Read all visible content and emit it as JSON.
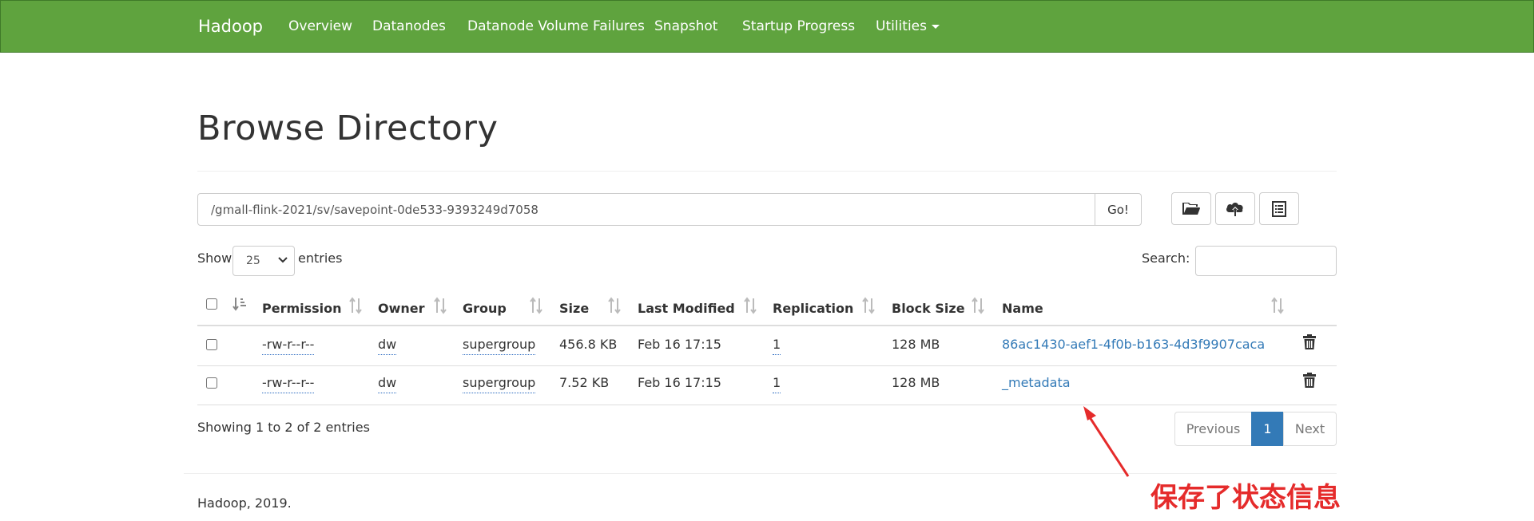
{
  "navbar": {
    "brand": "Hadoop",
    "items": [
      "Overview",
      "Datanodes",
      "Datanode Volume Failures",
      "Snapshot",
      "Startup Progress",
      "Utilities"
    ],
    "color": "#5fa33e"
  },
  "page": {
    "title": "Browse Directory"
  },
  "path_bar": {
    "value": "/gmall-flink-2021/sv/savepoint-0de533-9393249d7058",
    "go_label": "Go!",
    "tools": [
      "folder-open-icon",
      "cloud-upload-icon",
      "list-alt-icon"
    ]
  },
  "table_controls": {
    "show_label": "Show",
    "page_length": "25",
    "entries_label": "entries",
    "search_label": "Search:"
  },
  "table": {
    "columns": [
      "Permission",
      "Owner",
      "Group",
      "Size",
      "Last Modified",
      "Replication",
      "Block Size",
      "Name"
    ],
    "rows": [
      {
        "permission": "-rw-r--r--",
        "owner": "dw",
        "group": "supergroup",
        "size": "456.8 KB",
        "modified": "Feb 16 17:15",
        "replication": "1",
        "block_size": "128 MB",
        "name": "86ac1430-aef1-4f0b-b163-4d3f9907caca"
      },
      {
        "permission": "-rw-r--r--",
        "owner": "dw",
        "group": "supergroup",
        "size": "7.52 KB",
        "modified": "Feb 16 17:15",
        "replication": "1",
        "block_size": "128 MB",
        "name": "_metadata"
      }
    ]
  },
  "info": "Showing 1 to 2 of 2 entries",
  "pagination": {
    "previous": "Previous",
    "current": "1",
    "next": "Next",
    "active_color": "#337ab7"
  },
  "footer": {
    "text": "Hadoop, 2019."
  },
  "annotation": {
    "text": "保存了状态信息",
    "color": "#e52b2b"
  }
}
